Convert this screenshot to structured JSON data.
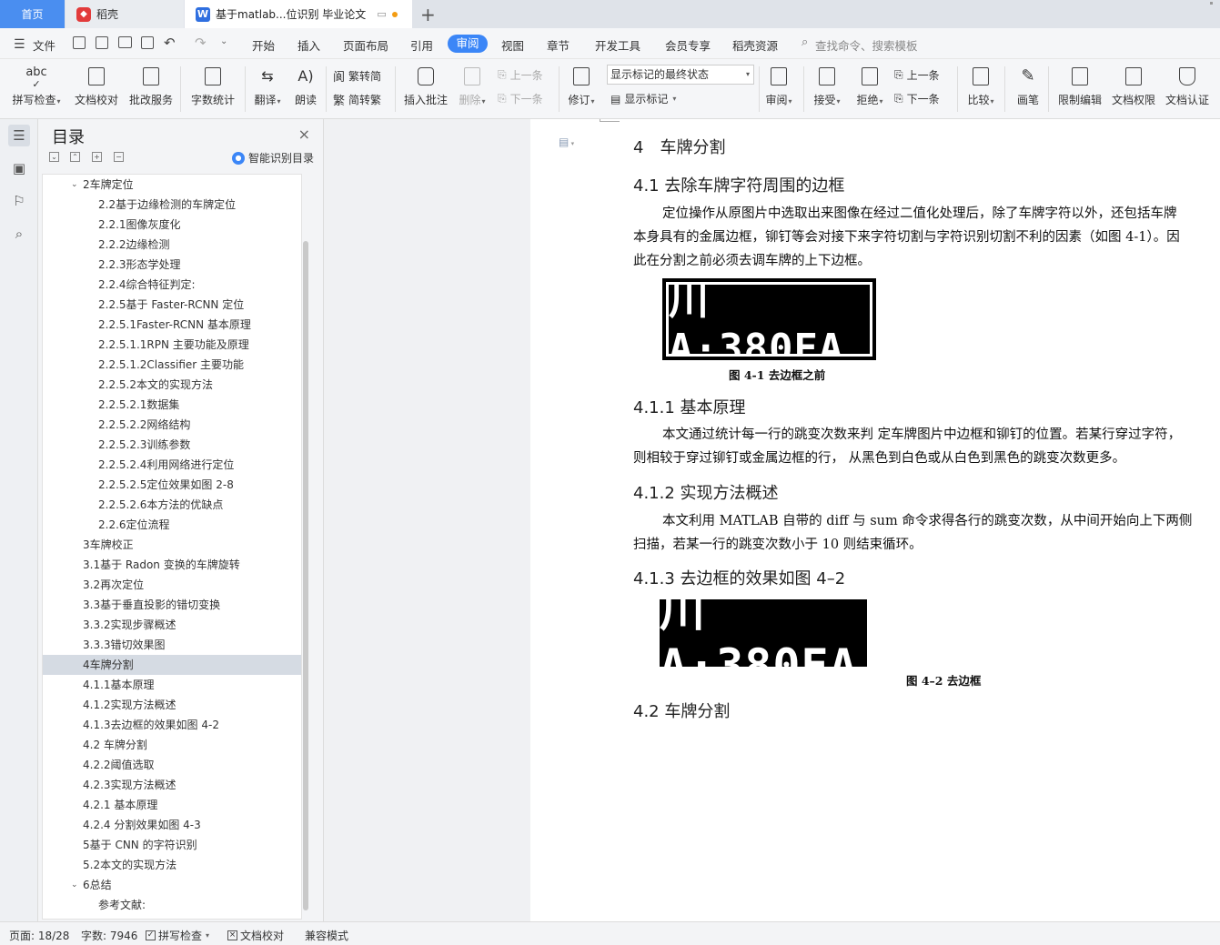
{
  "tabs": {
    "home": "首页",
    "daoke": "稻壳",
    "doc": "基于matlab...位识别 毕业论文"
  },
  "menu": {
    "file": "文件",
    "items": [
      "开始",
      "插入",
      "页面布局",
      "引用",
      "审阅",
      "视图",
      "章节",
      "开发工具",
      "会员专享",
      "稻壳资源"
    ],
    "active": "审阅",
    "search_placeholder": "查找命令、搜索模板"
  },
  "ribbon": {
    "spell": "拼写检查",
    "proof": "文档校对",
    "annotate_service": "批改服务",
    "wordcount": "字数统计",
    "translate": "翻译",
    "read": "朗读",
    "t2s": "繁转简",
    "s2t": "简转繁",
    "insert_comment": "插入批注",
    "delete": "删除",
    "prev_comment": "上一条",
    "next_comment": "下一条",
    "revise": "修订",
    "markup_select": "显示标记的最终状态",
    "show_markup": "显示标记",
    "review": "审阅",
    "accept": "接受",
    "reject": "拒绝",
    "prev": "上一条",
    "next": "下一条",
    "compare": "比较",
    "pen": "画笔",
    "restrict": "限制编辑",
    "permission": "文档权限",
    "certify": "文档认证"
  },
  "toc": {
    "title": "目录",
    "smart": "智能识别目录",
    "items": [
      {
        "text": "2车牌定位",
        "level": 1,
        "expand": true
      },
      {
        "text": "2.2基于边缘检测的车牌定位",
        "level": 2
      },
      {
        "text": "2.2.1图像灰度化",
        "level": 2
      },
      {
        "text": "2.2.2边缘检测",
        "level": 2
      },
      {
        "text": "2.2.3形态学处理",
        "level": 2
      },
      {
        "text": "2.2.4综合特征判定:",
        "level": 2
      },
      {
        "text": "2.2.5基于 Faster-RCNN 定位",
        "level": 2
      },
      {
        "text": "2.2.5.1Faster-RCNN 基本原理",
        "level": 2
      },
      {
        "text": "2.2.5.1.1RPN 主要功能及原理",
        "level": 2
      },
      {
        "text": "2.2.5.1.2Classifier 主要功能",
        "level": 2
      },
      {
        "text": "2.2.5.2本文的实现方法",
        "level": 2
      },
      {
        "text": "2.2.5.2.1数据集",
        "level": 2
      },
      {
        "text": "2.2.5.2.2网络结构",
        "level": 2
      },
      {
        "text": "2.2.5.2.3训练参数",
        "level": 2
      },
      {
        "text": "2.2.5.2.4利用网络进行定位",
        "level": 2
      },
      {
        "text": "2.2.5.2.5定位效果如图 2-8",
        "level": 2
      },
      {
        "text": "2.2.5.2.6本方法的优缺点",
        "level": 2
      },
      {
        "text": "2.2.6定位流程",
        "level": 2
      },
      {
        "text": "3车牌校正",
        "level": 1
      },
      {
        "text": "3.1基于 Radon 变换的车牌旋转",
        "level": 1
      },
      {
        "text": "3.2再次定位",
        "level": 1
      },
      {
        "text": "3.3基于垂直投影的错切变换",
        "level": 1
      },
      {
        "text": "3.3.2实现步骤概述",
        "level": 1
      },
      {
        "text": "3.3.3错切效果图",
        "level": 1
      },
      {
        "text": "4车牌分割",
        "level": 1,
        "selected": true
      },
      {
        "text": "4.1.1基本原理",
        "level": 1
      },
      {
        "text": "4.1.2实现方法概述",
        "level": 1
      },
      {
        "text": "4.1.3去边框的效果如图 4-2",
        "level": 1
      },
      {
        "text": "4.2 车牌分割",
        "level": 1
      },
      {
        "text": "4.2.2阈值选取",
        "level": 1
      },
      {
        "text": "4.2.3实现方法概述",
        "level": 1
      },
      {
        "text": "4.2.1 基本原理",
        "level": 1
      },
      {
        "text": "4.2.4 分割效果如图 4-3",
        "level": 1
      },
      {
        "text": "5基于 CNN 的字符识别",
        "level": 1
      },
      {
        "text": "5.2本文的实现方法",
        "level": 1
      },
      {
        "text": "6总结",
        "level": 1,
        "expand": true
      },
      {
        "text": "参考文献:",
        "level": 2
      }
    ]
  },
  "doc": {
    "h4": "4　车牌分割",
    "h41": "4.1 去除车牌字符周围的边框",
    "p1a": "定位操作从原图片中选取出来图像在经过二值化处理后，除了车牌字符以外，还包括车牌",
    "p1b": "本身具有的金属边框，铆钉等会对接下来字符切割与字符识别切割不利的因素（如图 4-1）。因",
    "p1c": "此在分割之前必须去调车牌的上下边框。",
    "plate1": "川A·380EA",
    "cap1": "图 4-1 去边框之前",
    "h411": "4.1.1 基本原理",
    "p2a": "本文通过统计每一行的跳变次数来判  定车牌图片中边框和铆钉的位置。若某行穿过字符，",
    "p2b": "则相较于穿过铆钉或金属边框的行，  从黑色到白色或从白色到黑色的跳变次数更多。",
    "h412": "4.1.2 实现方法概述",
    "p3a": "本文利用  MATLAB 自带的  diff 与 sum 命令求得各行的跳变次数，从中间开始向上下两侧",
    "p3b": "扫描，若某一行的跳变次数小于  10 则结束循环。",
    "h413": "4.1.3 去边框的效果如图 4–2",
    "plate2": "川A·380EA",
    "cap2": "图 4–2 去边框",
    "h42": "4.2 车牌分割"
  },
  "status": {
    "page": "页面: 18/28",
    "words": "字数: 7946",
    "spell": "拼写检查",
    "proof": "文档校对",
    "compat": "兼容模式"
  }
}
